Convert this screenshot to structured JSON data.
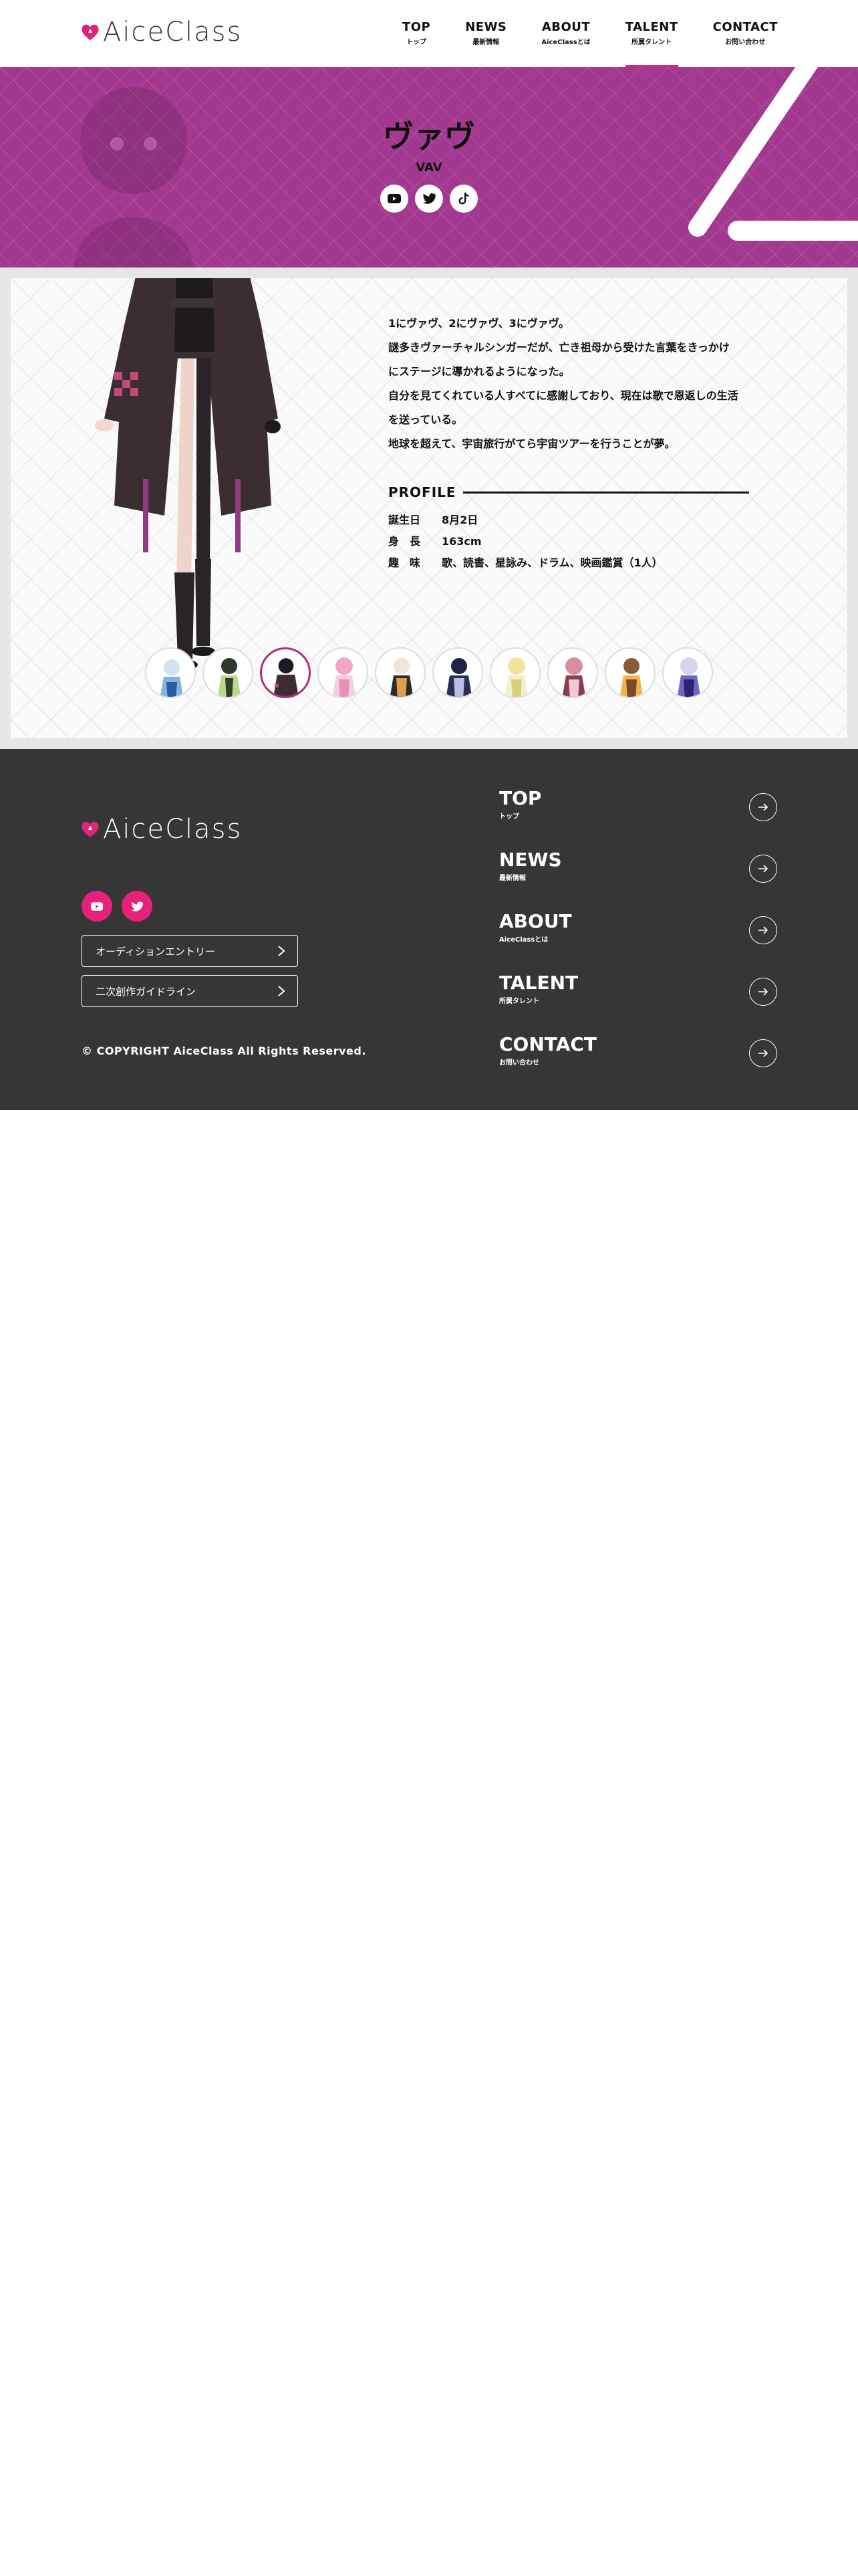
{
  "header": {
    "logo_text": "AiceClass",
    "nav": [
      {
        "en": "TOP",
        "ja": "トップ"
      },
      {
        "en": "NEWS",
        "ja": "最新情報"
      },
      {
        "en": "ABOUT",
        "ja": "AiceClassとは"
      },
      {
        "en": "TALENT",
        "ja": "所属タレント"
      },
      {
        "en": "CONTACT",
        "ja": "お問い合わせ"
      }
    ],
    "active_nav": "TALENT"
  },
  "hero": {
    "name": "ヴァヴ",
    "romaji": "VAV",
    "social": [
      "youtube-icon",
      "twitter-icon",
      "tiktok-icon"
    ],
    "background_color": "#a2388f"
  },
  "talent": {
    "description": [
      "1にヴァヴ、2にヴァヴ、3にヴァヴ。",
      "謎多きヴァーチャルシンガーだが、亡き祖母から受けた言葉をきっかけ",
      "にステージに導かれるようになった。",
      "自分を見てくれている人すべてに感謝しており、現在は歌で恩返しの生活",
      "を送っている。",
      "地球を超えて、宇宙旅行がてら宇宙ツアーを行うことが夢。"
    ],
    "profile_heading": "PROFILE",
    "profile": [
      {
        "key": "誕生日",
        "value": "8月2日"
      },
      {
        "key": "身　長",
        "value": "163cm"
      },
      {
        "key": "趣　味",
        "value": "歌、読書、星詠み、ドラム、映画鑑賞（1人）"
      }
    ],
    "thumbnails_count_active_index": 2
  },
  "footer": {
    "logo_text": "AiceClass",
    "social": [
      "youtube-icon",
      "twitter-icon"
    ],
    "buttons": [
      "オーディションエントリー",
      "二次創作ガイドライン"
    ],
    "copyright": "© COPYRIGHT AiceClass All Rights Reserved.",
    "nav": [
      {
        "en": "TOP",
        "ja": "トップ"
      },
      {
        "en": "NEWS",
        "ja": "最新情報"
      },
      {
        "en": "ABOUT",
        "ja": "AiceClassとは"
      },
      {
        "en": "TALENT",
        "ja": "所属タレント"
      },
      {
        "en": "CONTACT",
        "ja": "お問い合わせ"
      }
    ]
  },
  "colors": {
    "accent_pink": "#e0247c",
    "hero_purple": "#a2388f",
    "footer_bg": "#363636"
  }
}
